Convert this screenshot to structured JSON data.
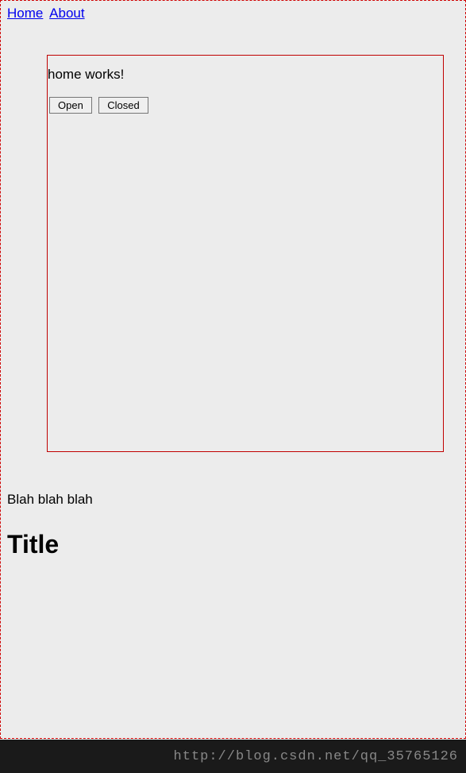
{
  "nav": {
    "home": "Home",
    "about": "About"
  },
  "content": {
    "heading": "home works!",
    "buttons": {
      "open": "Open",
      "closed": "Closed"
    }
  },
  "below": {
    "text": "Blah blah blah",
    "title": "Title"
  },
  "footer": {
    "url": "http://blog.csdn.net/qq_35765126"
  }
}
